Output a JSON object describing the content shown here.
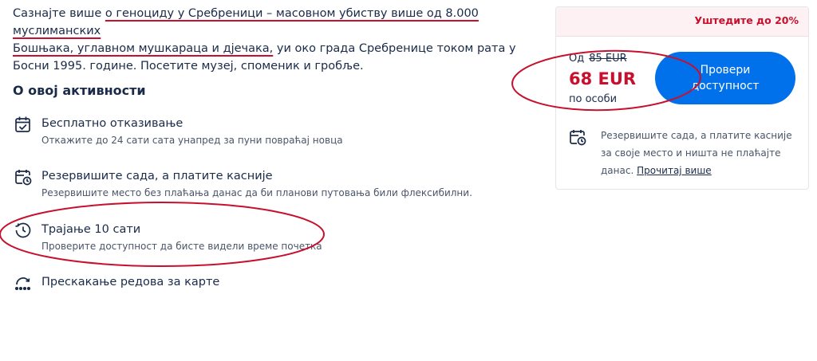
{
  "intro": {
    "part1": "Сазнајте више ",
    "part2": "о геноциду у Сребреници – масовном убиству више од 8.000 муслиманских",
    "part3": "Бошњака, углавном мушкараца и дјечака,",
    "part4": " уи око града Сребренице током рата у Босни 1995. године. Посетите музеј, споменик и гробље."
  },
  "section": {
    "title": "О овој активности"
  },
  "features": [
    {
      "title": "Бесплатно отказивање",
      "subtitle": "Откажите до 24 сати сата унапред за пуни повраћај новца",
      "icon": "calendar-check-icon"
    },
    {
      "title": "Резервишите сада, а платите касније",
      "subtitle": "Резервишите место без плаћања данас да би планови путовања били флексибилни.",
      "icon": "calendar-clock-icon"
    },
    {
      "title": "Трајање 10 сати",
      "subtitle": "Проверите доступност да бисте видели време почетка",
      "icon": "history-clock-icon"
    },
    {
      "title": "Прескакање редова за карте",
      "icon": "skip-line-icon"
    }
  ],
  "card": {
    "promo": "Уштедите до 20%",
    "from_label": "Од",
    "old_price": "85 EUR",
    "price": "68 EUR",
    "per": "по особи",
    "cta": "Провери доступност",
    "note": "Резервишите сада, а платите касније за своје место и ништа не плаћајте данас.",
    "note_link": "Прочитај више",
    "icon": "calendar-clock-icon"
  },
  "colors": {
    "accent": "#0071eb",
    "price": "#c8102e",
    "promo_bg": "#fdf1f3",
    "annotation": "#c8102e"
  }
}
